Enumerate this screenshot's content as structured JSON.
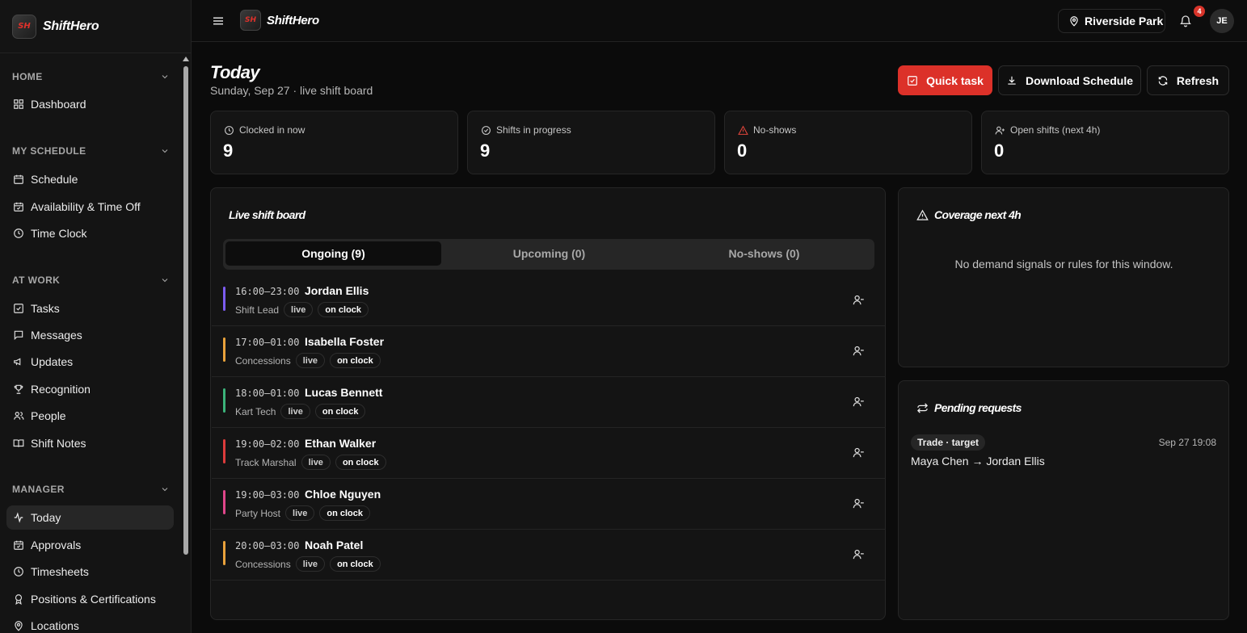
{
  "brand": {
    "name": "ShiftHero",
    "logo_text": "SH"
  },
  "sidebar": {
    "sections": [
      {
        "title": "HOME",
        "items": [
          {
            "label": "Dashboard",
            "icon": "dashboard-icon"
          }
        ]
      },
      {
        "title": "MY SCHEDULE",
        "items": [
          {
            "label": "Schedule",
            "icon": "calendar-icon"
          },
          {
            "label": "Availability & Time Off",
            "icon": "calendar-check-icon"
          },
          {
            "label": "Time Clock",
            "icon": "clock-icon"
          }
        ]
      },
      {
        "title": "AT WORK",
        "items": [
          {
            "label": "Tasks",
            "icon": "checkbox-icon"
          },
          {
            "label": "Messages",
            "icon": "message-icon"
          },
          {
            "label": "Updates",
            "icon": "megaphone-icon"
          },
          {
            "label": "Recognition",
            "icon": "trophy-icon"
          },
          {
            "label": "People",
            "icon": "people-icon"
          },
          {
            "label": "Shift Notes",
            "icon": "book-icon"
          }
        ]
      },
      {
        "title": "MANAGER",
        "items": [
          {
            "label": "Today",
            "icon": "activity-icon",
            "active": true
          },
          {
            "label": "Approvals",
            "icon": "calendar-check-icon"
          },
          {
            "label": "Timesheets",
            "icon": "clock-icon"
          },
          {
            "label": "Positions & Certifications",
            "icon": "award-icon"
          },
          {
            "label": "Locations",
            "icon": "map-pin-icon"
          }
        ]
      }
    ]
  },
  "topbar": {
    "location": "Riverside Park",
    "notifications": "4",
    "avatar_initials": "JE"
  },
  "page": {
    "title": "Today",
    "subtitle": "Sunday, Sep 27 · live shift board",
    "buttons": {
      "quick_task": "Quick task",
      "download": "Download Schedule",
      "refresh": "Refresh"
    }
  },
  "stats": [
    {
      "label": "Clocked in now",
      "value": "9",
      "icon": "clock-icon"
    },
    {
      "label": "Shifts in progress",
      "value": "9",
      "icon": "check-circle-icon"
    },
    {
      "label": "No-shows",
      "value": "0",
      "icon": "warning-icon"
    },
    {
      "label": "Open shifts (next 4h)",
      "value": "0",
      "icon": "user-plus-icon"
    }
  ],
  "board": {
    "title": "Live shift board",
    "tabs": [
      "Ongoing (9)",
      "Upcoming (0)",
      "No-shows (0)"
    ],
    "rows": [
      {
        "time": "16:00–23:00",
        "name": "Jordan Ellis",
        "role": "Shift Lead",
        "status1": "live",
        "status2": "on clock",
        "color": "#7c5cf0"
      },
      {
        "time": "17:00–01:00",
        "name": "Isabella Foster",
        "role": "Concessions",
        "status1": "live",
        "status2": "on clock",
        "color": "#e9a23b"
      },
      {
        "time": "18:00–01:00",
        "name": "Lucas Bennett",
        "role": "Kart Tech",
        "status1": "live",
        "status2": "on clock",
        "color": "#3bb37a"
      },
      {
        "time": "19:00–02:00",
        "name": "Ethan Walker",
        "role": "Track Marshal",
        "status1": "live",
        "status2": "on clock",
        "color": "#dc3b3b"
      },
      {
        "time": "19:00–03:00",
        "name": "Chloe Nguyen",
        "role": "Party Host",
        "status1": "live",
        "status2": "on clock",
        "color": "#e0468a"
      },
      {
        "time": "20:00–03:00",
        "name": "Noah Patel",
        "role": "Concessions",
        "status1": "live",
        "status2": "on clock",
        "color": "#e9a23b"
      }
    ]
  },
  "coverage": {
    "title": "Coverage next 4h",
    "empty": "No demand signals or rules for this window."
  },
  "requests": {
    "title": "Pending requests",
    "tag": "Trade · target",
    "date": "Sep 27 19:08",
    "text": "Maya Chen → Jordan Ellis"
  }
}
